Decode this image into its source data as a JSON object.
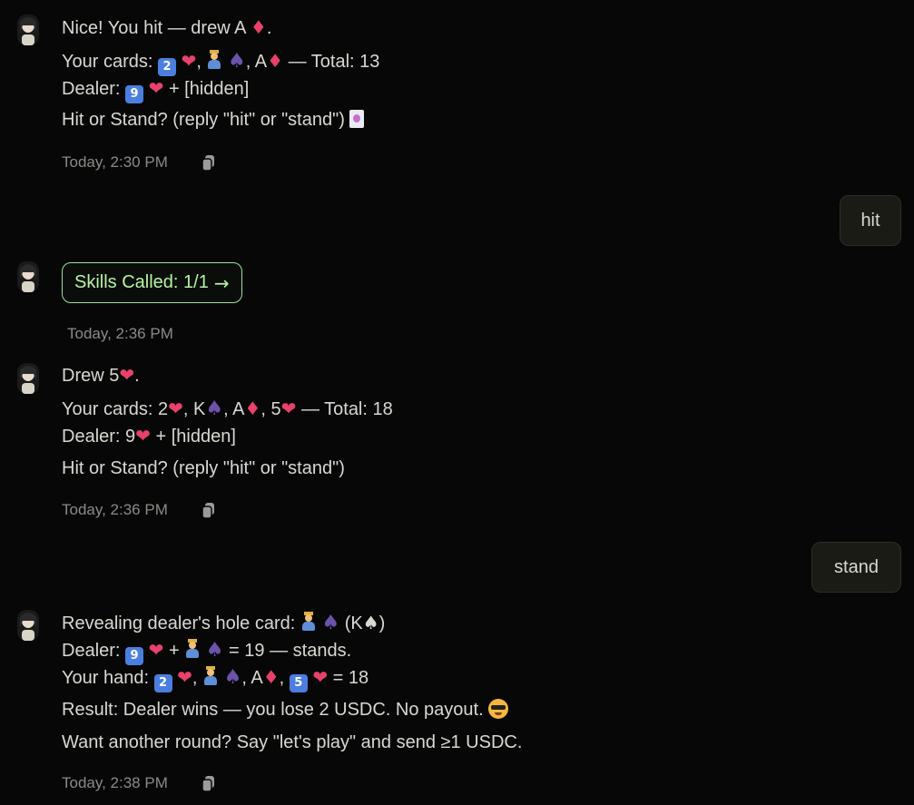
{
  "messages": [
    {
      "role": "assistant",
      "lines": {
        "l1a": "Nice! You hit — drew A",
        "l1b": ".",
        "l2a": "Your cards:",
        "l2b": ",",
        "l2c": ", A",
        "l2d": "— Total: 13",
        "l3a": "Dealer:",
        "l3b": "+ [hidden]",
        "l4a": "Hit or Stand? (reply \"hit\" or \"stand\")"
      },
      "timestamp": "Today, 2:30 PM"
    },
    {
      "role": "user",
      "text": "hit"
    },
    {
      "role": "assistant",
      "skills_button": "Skills Called: 1/1",
      "skills_arrow": "→",
      "timestamp": "Today, 2:36 PM"
    },
    {
      "role": "assistant",
      "lines": {
        "l1a": "Drew 5",
        "l1b": ".",
        "l2a": "Your cards: 2",
        "l2b": ", K",
        "l2c": ", A",
        "l2d": ", 5",
        "l2e": "— Total: 18",
        "l3a": "Dealer: 9",
        "l3b": "+ [hidden]",
        "l4a": "Hit or Stand? (reply \"hit\" or \"stand\")"
      },
      "timestamp": "Today, 2:36 PM"
    },
    {
      "role": "user",
      "text": "stand"
    },
    {
      "role": "assistant",
      "lines": {
        "l1a": "Revealing dealer's hole card:",
        "l1b": "(K",
        "l1c": ")",
        "l2a": "Dealer:",
        "l2b": "+",
        "l2c": "= 19 — stands.",
        "l3a": "Your hand:",
        "l3b": ",",
        "l3c": ", A",
        "l3d": ",",
        "l3e": "= 18",
        "l4a": "Result: Dealer wins — you lose 2 USDC. No payout.",
        "l5a": "Want another round? Say \"let's play\" and send ≥1 USDC."
      },
      "timestamp": "Today, 2:38 PM"
    }
  ],
  "glyphs": {
    "heart": "❤",
    "diamond": "♦",
    "spade": "♠",
    "keycap_2": "2",
    "keycap_9": "9",
    "keycap_5": "5"
  },
  "colors": {
    "background": "#070707",
    "text": "#d8d8d3",
    "timestamp": "#8a8a86",
    "skills_border": "#9ce29a",
    "user_bubble": "#1b1b16"
  }
}
